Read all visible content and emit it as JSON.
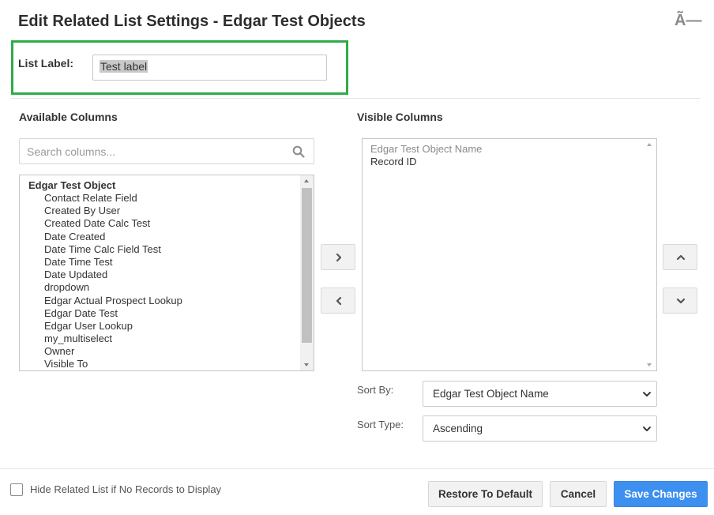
{
  "dialog": {
    "title": "Edit Related List Settings - Edgar Test Objects",
    "close_glyph": "Ã—"
  },
  "list_label": {
    "label": "List Label:",
    "value": "Test label"
  },
  "available": {
    "heading": "Available Columns",
    "search_placeholder": "Search columns...",
    "group": "Edgar Test Object",
    "items": [
      "Contact Relate Field",
      "Created By User",
      "Created Date Calc Test",
      "Date Created",
      "Date Time Calc Field Test",
      "Date Time Test",
      "Date Updated",
      "dropdown",
      "Edgar Actual Prospect Lookup",
      "Edgar Date Test",
      "Edgar User Lookup",
      "my_multiselect",
      "Owner",
      "Visible To"
    ]
  },
  "visible": {
    "heading": "Visible Columns",
    "items": [
      "Edgar Test Object Name",
      "Record ID"
    ]
  },
  "sort": {
    "by_label": "Sort By:",
    "by_value": "Edgar Test Object Name",
    "type_label": "Sort Type:",
    "type_value": "Ascending"
  },
  "footer": {
    "hide_checkbox_label": "Hide Related List if No Records to Display",
    "hide_checked": false,
    "restore_label": "Restore To Default",
    "cancel_label": "Cancel",
    "save_label": "Save Changes"
  },
  "colors": {
    "highlight_border": "#2eac4a",
    "primary_button": "#3d8ff0"
  }
}
